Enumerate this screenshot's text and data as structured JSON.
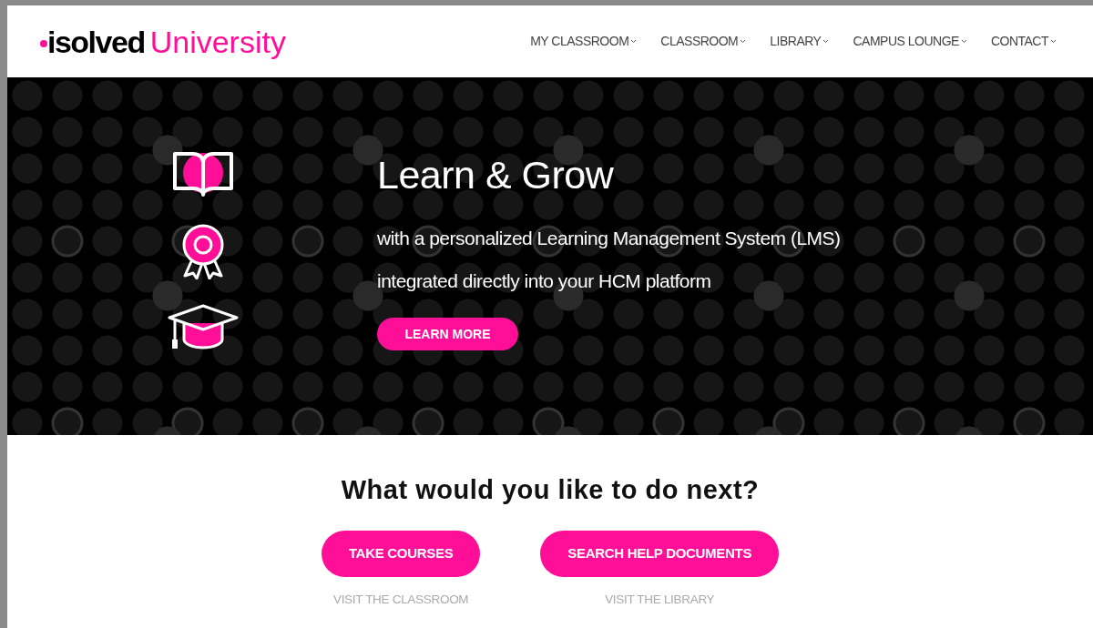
{
  "header": {
    "logo": {
      "brand": "isolved",
      "product": "University"
    },
    "nav": [
      {
        "label": "MY CLASSROOM"
      },
      {
        "label": "CLASSROOM"
      },
      {
        "label": "LIBRARY"
      },
      {
        "label": "CAMPUS LOUNGE"
      },
      {
        "label": "CONTACT"
      }
    ]
  },
  "hero": {
    "title": "Learn & Grow",
    "lines": [
      "with a personalized Learning Management System (LMS)",
      "integrated directly into your HCM platform"
    ],
    "button": "LEARN MORE"
  },
  "next": {
    "heading": "What would you like to do next?",
    "actions": [
      {
        "button": "TAKE COURSES",
        "link": "VISIT THE CLASSROOM"
      },
      {
        "button": "SEARCH HELP DOCUMENTS",
        "link": "VISIT THE LIBRARY"
      }
    ]
  }
}
